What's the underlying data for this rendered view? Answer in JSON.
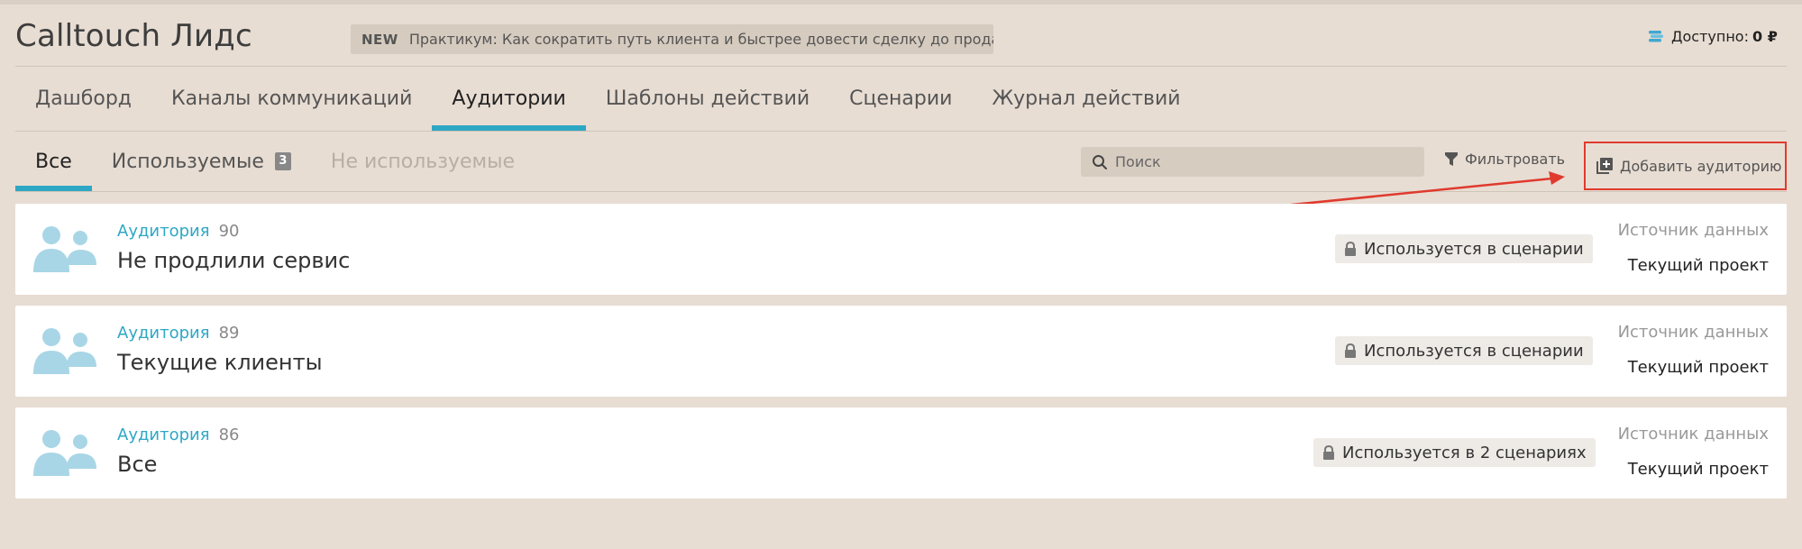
{
  "header": {
    "app_title": "Calltouch Лидс",
    "promo_badge": "NEW",
    "promo_text": "Практикум: Как сократить путь клиента и быстрее довести сделку до продажи",
    "balance_label": "Доступно:",
    "balance_value": "0 ₽"
  },
  "main_tabs": [
    {
      "label": "Дашборд"
    },
    {
      "label": "Каналы коммуникаций"
    },
    {
      "label": "Аудитории"
    },
    {
      "label": "Шаблоны действий"
    },
    {
      "label": "Сценарии"
    },
    {
      "label": "Журнал действий"
    }
  ],
  "sub_tabs": [
    {
      "label": "Все"
    },
    {
      "label": "Используемые",
      "count": "3"
    },
    {
      "label": "Не используемые"
    }
  ],
  "toolbar": {
    "search_placeholder": "Поиск",
    "filter_label": "Фильтровать",
    "add_label": "Добавить аудиторию"
  },
  "audiences": [
    {
      "kind": "Аудитория",
      "number": "90",
      "name": "Не продлили сервис",
      "usage": "Используется в сценарии",
      "source_label": "Источник данных",
      "source_value": "Текущий проект"
    },
    {
      "kind": "Аудитория",
      "number": "89",
      "name": "Текущие клиенты",
      "usage": "Используется в сценарии",
      "source_label": "Источник данных",
      "source_value": "Текущий проект"
    },
    {
      "kind": "Аудитория",
      "number": "86",
      "name": "Все",
      "usage": "Используется в 2 сценариях",
      "source_label": "Источник данных",
      "source_value": "Текущий проект"
    }
  ],
  "colors": {
    "accent": "#2ea7c4",
    "background": "#e8ddd3",
    "annotation": "#e03a2e"
  }
}
